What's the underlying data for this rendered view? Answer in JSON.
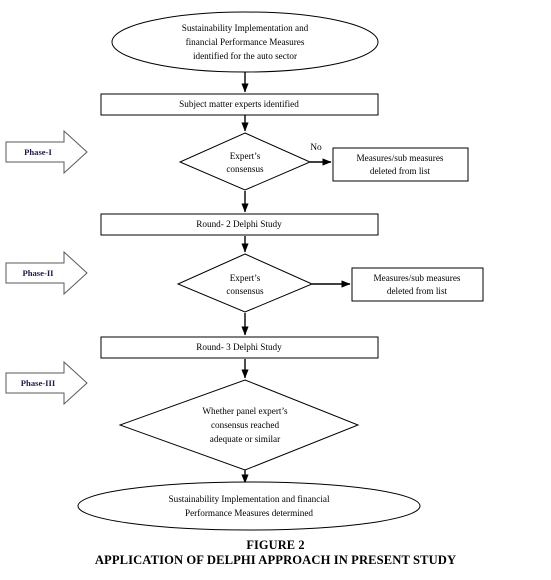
{
  "figure": {
    "caption_line1": "FIGURE 2",
    "caption_line2": "APPLICATION OF DELPHI APPROACH IN PRESENT STUDY"
  },
  "nodes": {
    "start_ellipse": {
      "shape": "ellipse",
      "line1": "Sustainability Implementation and",
      "line2": "financial Performance Measures",
      "line3": "identified for the auto sector"
    },
    "experts_box": {
      "shape": "process",
      "line1": "Subject matter experts identified"
    },
    "decision1": {
      "shape": "decision",
      "line1": "Expert’s",
      "line2": "consensus"
    },
    "deleted_box1": {
      "shape": "process",
      "line1": "Measures/sub measures",
      "line2": "deleted from list"
    },
    "round2_box": {
      "shape": "process",
      "line1": "Round- 2 Delphi Study"
    },
    "decision2": {
      "shape": "decision",
      "line1": "Expert’s",
      "line2": "consensus"
    },
    "deleted_box2": {
      "shape": "process",
      "line1": "Measures/sub measures",
      "line2": "deleted from list"
    },
    "round3_box": {
      "shape": "process",
      "line1": "Round- 3 Delphi Study"
    },
    "decision3": {
      "shape": "decision",
      "line1": "Whether panel expert’s",
      "line2": "consensus reached",
      "line3": "adequate or similar"
    },
    "end_ellipse": {
      "shape": "ellipse",
      "line1": "Sustainability Implementation and financial",
      "line2": "Performance Measures determined"
    }
  },
  "phases": [
    {
      "label": "Phase-I"
    },
    {
      "label": "Phase-II"
    },
    {
      "label": "Phase-III"
    }
  ],
  "edge_labels": {
    "decision1_no": "No"
  },
  "colors": {
    "stroke": "#000000",
    "fill": "#ffffff",
    "phase_stroke": "#5a5a5a",
    "phase_text": "#1a1a4d"
  }
}
